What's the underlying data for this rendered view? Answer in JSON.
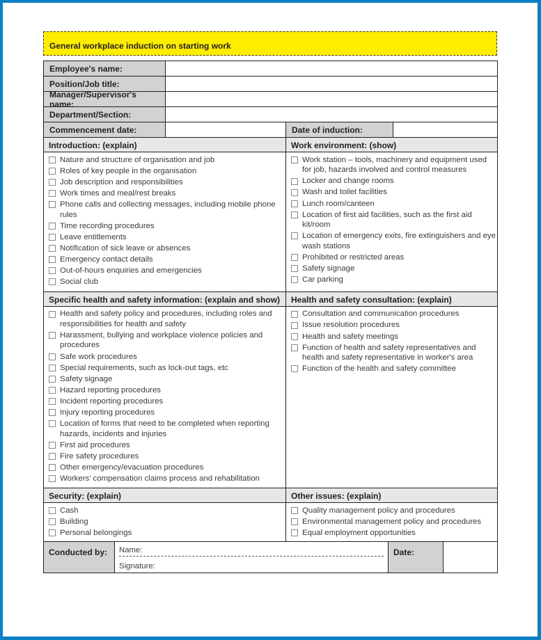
{
  "title": "General workplace induction on starting work",
  "fields": {
    "employee_name": "Employee's name:",
    "position": "Position/Job title:",
    "manager": "Manager/Supervisor's name:",
    "department": "Department/Section:",
    "commencement": "Commencement date:",
    "induction_date": "Date of induction:"
  },
  "sections": {
    "introduction": {
      "heading": "Introduction: (explain)",
      "items": [
        "Nature and structure of organisation and job",
        "Roles of key people in the organisation",
        "Job description and responsibilities",
        "Work times and meal/rest breaks",
        "Phone calls and collecting messages, including mobile phone rules",
        "Time recording procedures",
        "Leave entitlements",
        "Notification of sick leave or absences",
        "Emergency contact details",
        "Out-of-hours enquiries and emergencies",
        "Social club"
      ]
    },
    "work_environment": {
      "heading": "Work environment: (show)",
      "items": [
        "Work station – tools, machinery and equipment used for job, hazards involved and control measures",
        "Locker and change rooms",
        "Wash and toilet facilities",
        "Lunch room/canteen",
        "Location of first aid facilities, such as the first aid kit/room",
        "Location of emergency exits, fire extinguishers and eye wash stations",
        "Prohibited or restricted areas",
        "Safety signage",
        "Car parking"
      ]
    },
    "specific_hs": {
      "heading": "Specific health and safety information: (explain and show)",
      "items": [
        "Health and safety policy and procedures, including roles and responsibilities for health and safety",
        "Harassment, bullying and workplace violence policies and procedures",
        "Safe work procedures",
        "Special requirements, such as lock-out tags, etc",
        "Safety signage",
        "Hazard reporting procedures",
        "Incident reporting procedures",
        "Injury reporting procedures",
        "Location of forms that need to be completed when reporting hazards, incidents and injuries",
        "First aid procedures",
        "Fire safety procedures",
        "Other emergency/evacuation procedures",
        "Workers' compensation claims process and rehabilitation"
      ]
    },
    "hs_consultation": {
      "heading": "Health and safety consultation: (explain)",
      "items": [
        "Consultation and communication procedures",
        "Issue resolution procedures",
        "Health and safety meetings",
        "Function of health and safety representatives and health and safety representative in worker's area",
        "Function of the health and safety committee"
      ]
    },
    "security": {
      "heading": "Security: (explain)",
      "items": [
        "Cash",
        "Building",
        "Personal belongings"
      ]
    },
    "other_issues": {
      "heading": "Other issues: (explain)",
      "items": [
        "Quality management policy and procedures",
        "Environmental management policy and procedures",
        "Equal employment opportunities"
      ]
    }
  },
  "footer": {
    "conducted_by": "Conducted by:",
    "name": "Name:",
    "signature": "Signature:",
    "date": "Date:"
  },
  "colors": {
    "frame": "#0a7fc4",
    "title_bg": "#ffed00",
    "label_bg": "#d1d2d4",
    "section_bg": "#e6e7e8"
  }
}
